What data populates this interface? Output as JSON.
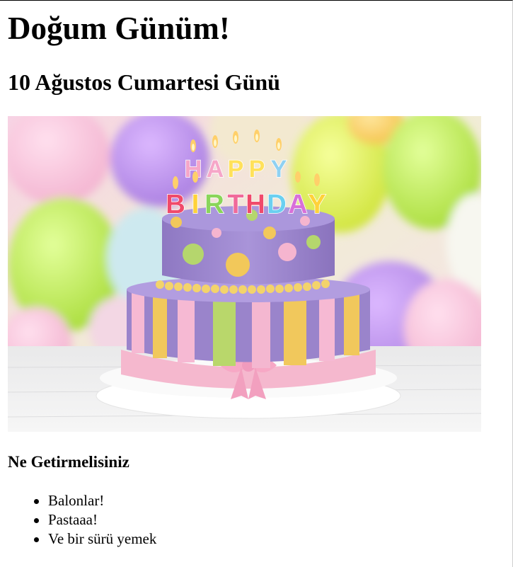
{
  "page": {
    "title": "Doğum Günüm!",
    "date": "10 Ağustos Cumartesi Günü"
  },
  "image": {
    "description_icon": "birthday-cake-photo",
    "candle_letters": "HAPPY BIRTHDAY"
  },
  "bring": {
    "heading": "Ne Getirmelisiniz",
    "items": [
      "Balonlar!",
      "Pastaaa!",
      "Ve bir sürü yemek"
    ]
  },
  "colors": {
    "cake_purple": "#9d86cc",
    "ribbon_pink": "#f4b6cc",
    "stripe_yellow": "#f2c85a",
    "stripe_green": "#b6d86b"
  }
}
